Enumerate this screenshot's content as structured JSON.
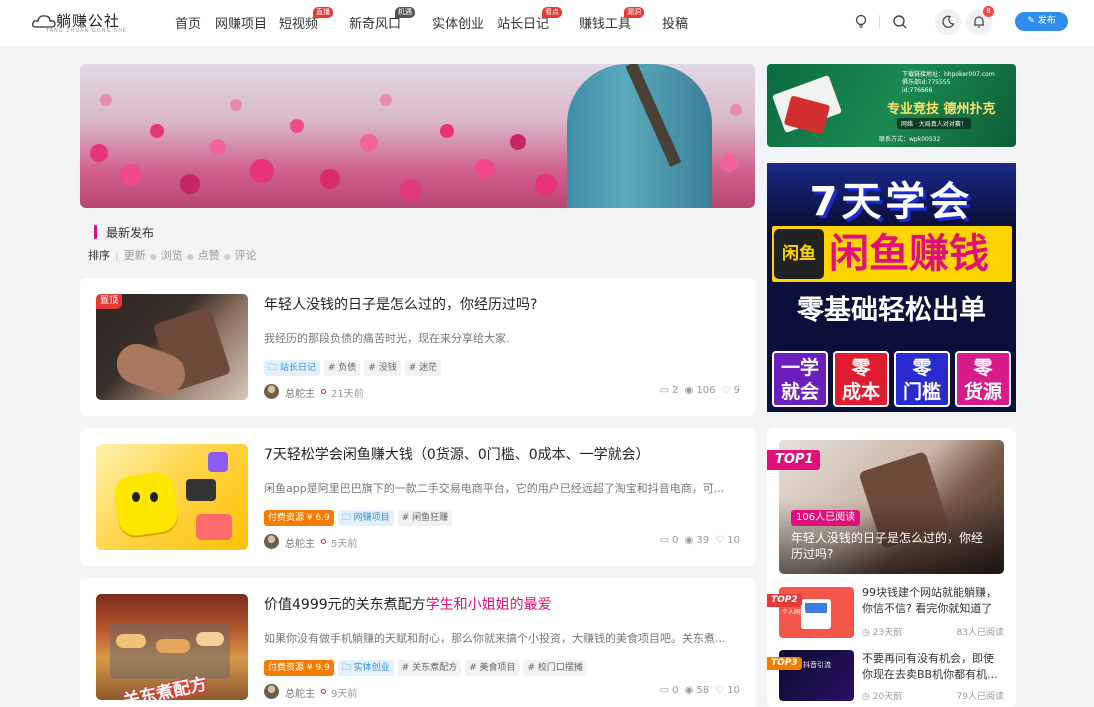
{
  "header": {
    "logo_name": "躺赚公社",
    "logo_sub": "TANG ZHUAN GONG SHE",
    "nav": [
      {
        "label": "首页",
        "badge": ""
      },
      {
        "label": "网赚项目",
        "badge": ""
      },
      {
        "label": "短视频",
        "badge": "直播"
      },
      {
        "label": "新奇风口",
        "badge": "机遇"
      },
      {
        "label": "实体创业",
        "badge": ""
      },
      {
        "label": "站长日记",
        "badge": "看点"
      },
      {
        "label": "赚钱工具",
        "badge": "漏洞"
      },
      {
        "label": "投稿",
        "badge": ""
      }
    ],
    "notification_count": "8",
    "publish_label": "发布"
  },
  "section": {
    "title": "最新发布",
    "sort_label": "排序",
    "sort_options": [
      "更新",
      "浏览",
      "点赞",
      "评论"
    ]
  },
  "posts": [
    {
      "title": "年轻人没钱的日子是怎么过的，你经历过吗?",
      "title_highlight": "",
      "pinned_label": "置顶",
      "desc": "我经历的那段负债的痛苦时光，现在来分享给大家.",
      "paid": "",
      "category": "站长日记",
      "tags": [
        "# 负债",
        "# 没钱",
        "# 迷茫"
      ],
      "author": "总舵主",
      "time": "21天前",
      "comments": "2",
      "views": "106",
      "likes": "9"
    },
    {
      "title": "7天轻松学会闲鱼赚大钱（0货源、0门槛、0成本、一学就会）",
      "title_highlight": "",
      "pinned_label": "",
      "desc": "闲鱼app是阿里巴巴旗下的一款二手交易电商平台，它的用户已经远超了淘宝和抖音电商，可...",
      "paid": "付费资源 ¥ 6.9",
      "category": "网赚项目",
      "tags": [
        "# 闲鱼狂赚"
      ],
      "author": "总舵主",
      "time": "5天前",
      "comments": "0",
      "views": "39",
      "likes": "10"
    },
    {
      "title": "价值4999元的关东煮配方",
      "title_highlight": "学生和小姐姐的最爱",
      "pinned_label": "",
      "desc": "如果你没有做手机躺赚的天赋和耐心，那么你就来搞个小投资，大赚钱的美食项目吧。关东煮...",
      "paid": "付费资源 ¥ 9.9",
      "category": "实体创业",
      "tags": [
        "# 关东煮配方",
        "# 美食项目",
        "# 校门口摆摊"
      ],
      "author": "总舵主",
      "time": "9天前",
      "comments": "0",
      "views": "58",
      "likes": "10",
      "thumb_text": "关东煮配方"
    }
  ],
  "ads": {
    "ad1": {
      "lines": [
        "下载链接地址：hhpoker007.com",
        "俱乐部id:775555",
        "id:776666"
      ],
      "headline": "专业竞技 德州扑克",
      "sub": "网络 · 大局真人对对赛！",
      "contact": "联系方式：wpk00532"
    },
    "ad2": {
      "line1": "7天学会",
      "logo": "闲鱼",
      "line2": "闲鱼赚钱",
      "line3": "零基础轻松出单",
      "boxes": [
        [
          "一学",
          "就会"
        ],
        [
          "零",
          "成本"
        ],
        [
          "零",
          "门槛"
        ],
        [
          "零",
          "货源"
        ]
      ]
    }
  },
  "hot": {
    "top1": {
      "rank": "TOP1",
      "reads": "106人已阅读",
      "title": "年轻人没钱的日子是怎么过的，你经历过吗?"
    },
    "items": [
      {
        "rank": "TOP2",
        "title": "99块钱建个网站就能躺赚，你信不信? 看完你就知道了",
        "time": "23天前",
        "reads": "83人已阅读",
        "thumb_text": "个人网站"
      },
      {
        "rank": "TOP3",
        "title": "不要再问有没有机会，即使你现在去卖BB机你都有机...",
        "time": "20天前",
        "reads": "79人已阅读",
        "thumb_text": "抖音引流"
      }
    ]
  },
  "colors": {
    "accent": "#2f8df0",
    "highlight": "#e0107b",
    "paid": "#f57c00",
    "badge_red": "#e53935",
    "badge_gray": "#555555"
  }
}
